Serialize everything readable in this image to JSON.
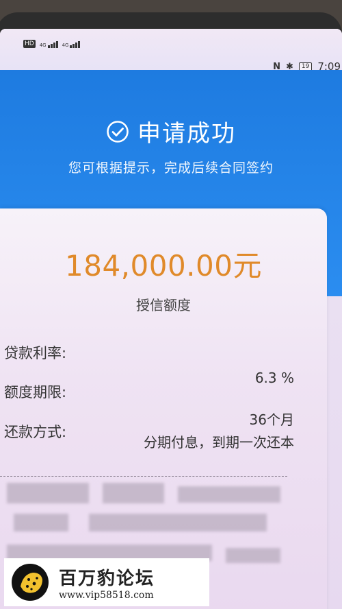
{
  "status_bar": {
    "hd_badge": "HD",
    "signal_1": "4G",
    "signal_2": "4G",
    "battery": "19",
    "time": "7:09"
  },
  "header": {
    "title": "申请成功",
    "subtitle": "您可根据提示，完成后续合同签约"
  },
  "credit": {
    "amount": "184,000.00元",
    "amount_label": "授信额度"
  },
  "details": [
    {
      "label": "贷款利率:",
      "value": "6.3 %"
    },
    {
      "label": "额度期限:",
      "value": "36个月"
    },
    {
      "label": "还款方式:",
      "value": "分期付息，到期一次还本"
    }
  ],
  "watermark": {
    "name": "百万豹论坛",
    "url": "www.vip58518.com"
  },
  "colors": {
    "header_blue": "#1e7be0",
    "amount_orange": "#e08a2a"
  }
}
